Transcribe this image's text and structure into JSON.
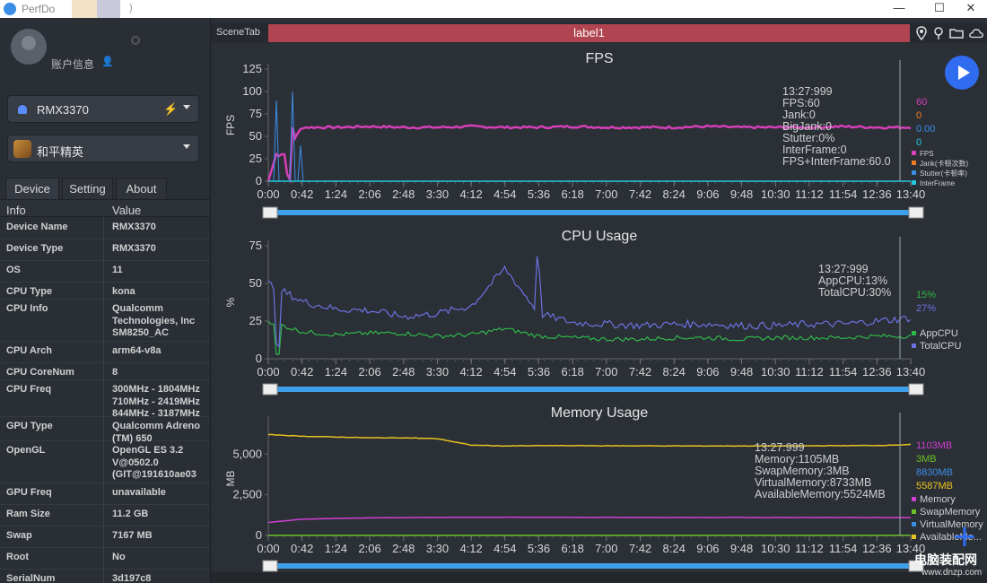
{
  "window": {
    "title": "PerfDo",
    "paren": ")"
  },
  "sidebar": {
    "account_label": "账户信息",
    "device_select": "RMX3370",
    "app_select": "和平精英",
    "tabs": [
      "Device",
      "Setting",
      "About"
    ],
    "info_headers": {
      "key": "Info",
      "value": "Value"
    },
    "rows": [
      {
        "k": "Device Name",
        "v": "RMX3370"
      },
      {
        "k": "Device Type",
        "v": "RMX3370"
      },
      {
        "k": "OS",
        "v": "11"
      },
      {
        "k": "CPU Type",
        "v": "kona"
      },
      {
        "k": "CPU Info",
        "v": "Qualcomm\nTechnologies, Inc\nSM8250_AC"
      },
      {
        "k": "CPU Arch",
        "v": "arm64-v8a"
      },
      {
        "k": "CPU CoreNum",
        "v": "8"
      },
      {
        "k": "CPU Freq",
        "v": "300MHz - 1804MHz\n710MHz - 2419MHz\n844MHz - 3187MHz"
      },
      {
        "k": "GPU Type",
        "v": "Qualcomm Adreno\n(TM) 650"
      },
      {
        "k": "OpenGL",
        "v": "OpenGL ES 3.2\nV@0502.0\n(GIT@191610ae03"
      },
      {
        "k": "GPU Freq",
        "v": "unavailable"
      },
      {
        "k": "Ram Size",
        "v": "11.2 GB"
      },
      {
        "k": "Swap",
        "v": "7167 MB"
      },
      {
        "k": "Root",
        "v": "No"
      },
      {
        "k": "SerialNum",
        "v": "3d197c8"
      }
    ]
  },
  "scene": {
    "tab_label": "SceneTab",
    "label": "label1"
  },
  "colors": {
    "fps": "#d63fb8",
    "jank": "#f07b1f",
    "stutter": "#3a8ee6",
    "interframe": "#24c6e0",
    "appcpu": "#2fb84a",
    "totalcpu": "#6b72e0",
    "memory": "#cf3fd0",
    "swap": "#6cc027",
    "virtual": "#3a8ee6",
    "available": "#e6c21e",
    "accent": "#2f6cf0",
    "scene": "#b04450"
  },
  "x_ticks": [
    "0:00",
    "0:42",
    "1:24",
    "2:06",
    "2:48",
    "3:30",
    "4:12",
    "4:54",
    "5:36",
    "6:18",
    "7:00",
    "7:42",
    "8:24",
    "9:06",
    "9:48",
    "10:30",
    "11:12",
    "11:54",
    "12:36",
    "13:40"
  ],
  "charts": {
    "fps": {
      "title": "FPS",
      "ylabel": "FPS",
      "ticks": [
        "0",
        "25",
        "50",
        "75",
        "100",
        "125"
      ],
      "tooltip": [
        "13:27:999",
        "FPS:60",
        "Jank:0",
        "BigJank:0",
        "Stutter:0%",
        "InterFrame:0",
        "FPS+InterFrame:60.0"
      ],
      "values": [
        "60",
        "0",
        "0.00",
        "0"
      ],
      "legend": [
        "FPS",
        "Jank(卡顿次数)",
        "Stutter(卡顿率)",
        "InterFrame"
      ]
    },
    "cpu": {
      "title": "CPU Usage",
      "ylabel": "%",
      "ticks": [
        "0",
        "25",
        "50",
        "75"
      ],
      "tooltip": [
        "13:27:999",
        "AppCPU:13%",
        "TotalCPU:30%"
      ],
      "values": [
        "15%",
        "27%"
      ],
      "legend": [
        "AppCPU",
        "TotalCPU"
      ]
    },
    "memory": {
      "title": "Memory Usage",
      "ylabel": "MB",
      "ticks": [
        "0",
        "2,500",
        "5,000"
      ],
      "tooltip": [
        "13:27:999",
        "Memory:1105MB",
        "SwapMemory:3MB",
        "VirtualMemory:8733MB",
        "AvailableMemory:5524MB"
      ],
      "values": [
        "1103MB",
        "3MB",
        "8830MB",
        "5587MB"
      ],
      "legend": [
        "Memory",
        "SwapMemory",
        "VirtualMemory",
        "AvailableMe..."
      ]
    }
  },
  "watermark": {
    "line1": "电脑装配网",
    "line2": "www.dnzp.com"
  },
  "chart_data": [
    {
      "type": "line",
      "title": "FPS",
      "ylabel": "FPS",
      "ylim": [
        0,
        125
      ],
      "x": [
        "0:00",
        "0:42",
        "1:24",
        "2:06",
        "2:48",
        "3:30",
        "4:12",
        "4:54",
        "5:36",
        "6:18",
        "7:00",
        "7:42",
        "8:24",
        "9:06",
        "9:48",
        "10:30",
        "11:12",
        "11:54",
        "12:36",
        "13:40"
      ],
      "series": [
        {
          "name": "FPS",
          "values": [
            5,
            60,
            60,
            61,
            60,
            60,
            61,
            60,
            60,
            61,
            60,
            60,
            60,
            61,
            60,
            60,
            60,
            61,
            60,
            60
          ]
        },
        {
          "name": "Jank(卡顿次数)",
          "values": [
            0,
            0,
            0,
            0,
            0,
            0,
            0,
            0,
            0,
            0,
            0,
            0,
            0,
            0,
            0,
            0,
            0,
            0,
            0,
            0
          ]
        },
        {
          "name": "Stutter(卡顿率)",
          "values": [
            0,
            0,
            0,
            0,
            0,
            0,
            0,
            0,
            0,
            0,
            0,
            0,
            0,
            0,
            0,
            0,
            0,
            0,
            0,
            0
          ]
        },
        {
          "name": "InterFrame",
          "values": [
            0,
            0,
            0,
            0,
            0,
            0,
            0,
            0,
            0,
            0,
            0,
            0,
            0,
            0,
            0,
            0,
            0,
            0,
            0,
            0
          ]
        }
      ]
    },
    {
      "type": "line",
      "title": "CPU Usage",
      "ylabel": "%",
      "ylim": [
        0,
        75
      ],
      "x": [
        "0:00",
        "0:42",
        "1:24",
        "2:06",
        "2:48",
        "3:30",
        "4:12",
        "4:54",
        "5:36",
        "6:18",
        "7:00",
        "7:42",
        "8:24",
        "9:06",
        "9:48",
        "10:30",
        "11:12",
        "11:54",
        "12:36",
        "13:40"
      ],
      "series": [
        {
          "name": "AppCPU",
          "values": [
            25,
            18,
            16,
            17,
            17,
            15,
            16,
            20,
            15,
            14,
            13,
            13,
            14,
            14,
            13,
            14,
            14,
            14,
            15,
            15
          ]
        },
        {
          "name": "TotalCPU",
          "values": [
            50,
            38,
            33,
            32,
            28,
            30,
            35,
            60,
            30,
            24,
            23,
            22,
            23,
            23,
            22,
            22,
            23,
            23,
            25,
            27
          ]
        }
      ]
    },
    {
      "type": "line",
      "title": "Memory Usage",
      "ylabel": "MB",
      "ylim": [
        0,
        7000
      ],
      "x": [
        "0:00",
        "0:42",
        "1:24",
        "2:06",
        "2:48",
        "3:30",
        "4:12",
        "4:54",
        "5:36",
        "6:18",
        "7:00",
        "7:42",
        "8:24",
        "9:06",
        "9:48",
        "10:30",
        "11:12",
        "11:54",
        "12:36",
        "13:40"
      ],
      "series": [
        {
          "name": "Memory",
          "values": [
            800,
            1000,
            1050,
            1080,
            1100,
            1110,
            1110,
            1120,
            1120,
            1110,
            1110,
            1110,
            1105,
            1105,
            1105,
            1105,
            1105,
            1105,
            1105,
            1103
          ]
        },
        {
          "name": "SwapMemory",
          "values": [
            3,
            3,
            3,
            3,
            3,
            3,
            3,
            3,
            3,
            3,
            3,
            3,
            3,
            3,
            3,
            3,
            3,
            3,
            3,
            3
          ]
        },
        {
          "name": "AvailableMemory",
          "values": [
            6200,
            6100,
            6050,
            6000,
            6000,
            5950,
            5550,
            5500,
            5520,
            5520,
            5510,
            5510,
            5500,
            5500,
            5500,
            5500,
            5510,
            5520,
            5530,
            5587
          ]
        }
      ]
    }
  ]
}
